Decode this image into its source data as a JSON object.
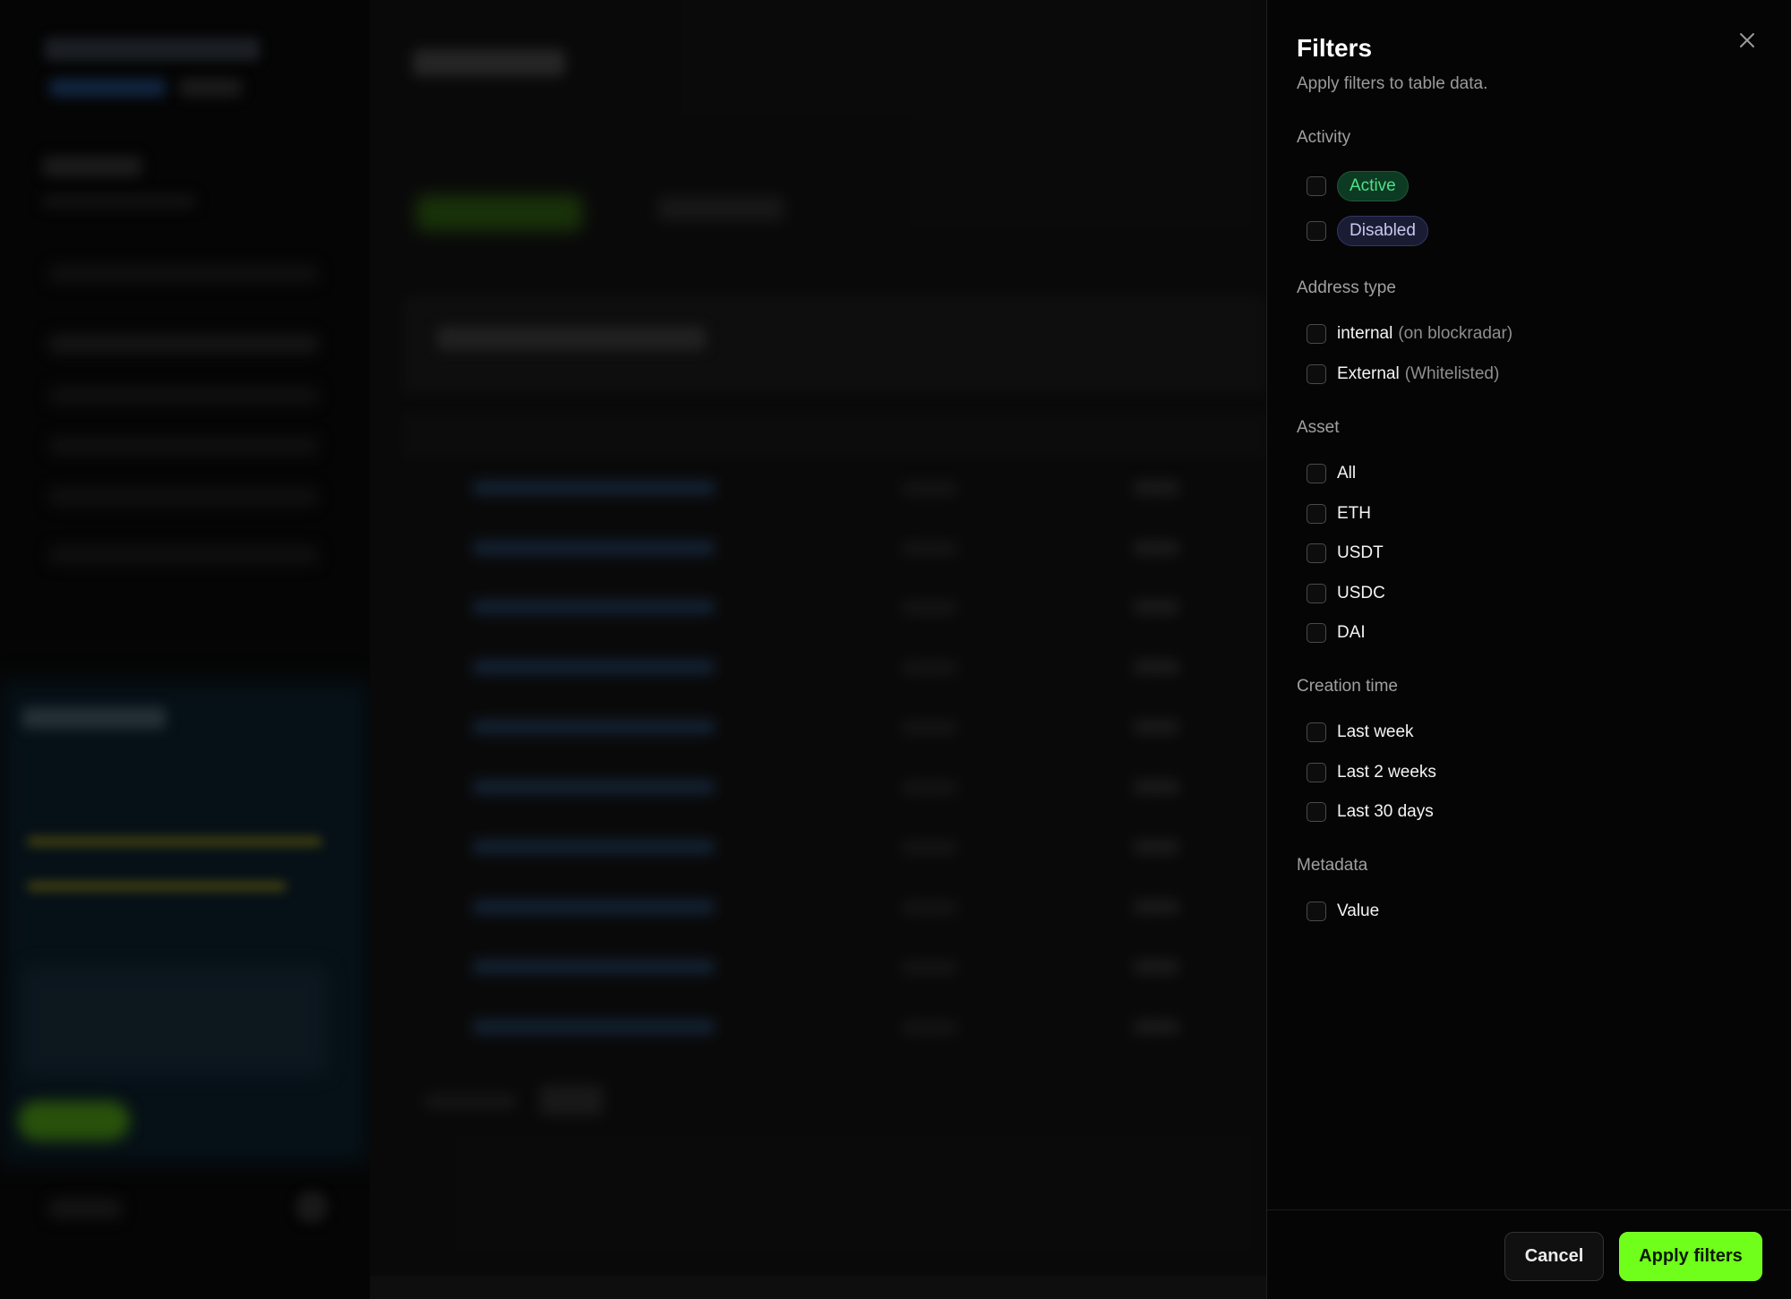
{
  "drawer": {
    "title": "Filters",
    "subtitle": "Apply filters to table data.",
    "close_icon": "close-icon",
    "sections": {
      "activity": {
        "label": "Activity",
        "options": [
          {
            "label": "Active",
            "checked": false,
            "color": "#4fe08a"
          },
          {
            "label": "Disabled",
            "checked": false,
            "color": "#c6c8f0"
          }
        ]
      },
      "address_type": {
        "label": "Address type",
        "options": [
          {
            "label": "internal",
            "extra": "(on blockradar)",
            "checked": false
          },
          {
            "label": "External",
            "extra": "(Whitelisted)",
            "checked": false
          }
        ]
      },
      "asset": {
        "label": "Asset",
        "options": [
          {
            "label": "All",
            "checked": false
          },
          {
            "label": "ETH",
            "checked": false
          },
          {
            "label": "USDT",
            "checked": false
          },
          {
            "label": "USDC",
            "checked": false
          },
          {
            "label": "DAI",
            "checked": false
          }
        ]
      },
      "creation_time": {
        "label": "Creation time",
        "options": [
          {
            "label": "Last week",
            "checked": false
          },
          {
            "label": "Last 2 weeks",
            "checked": false
          },
          {
            "label": "Last 30 days",
            "checked": false
          }
        ]
      },
      "metadata": {
        "label": "Metadata",
        "options": [
          {
            "label": "Value",
            "checked": false
          }
        ]
      }
    },
    "footer": {
      "cancel_label": "Cancel",
      "apply_label": "Apply filters",
      "apply_color": "#6fff1a"
    }
  }
}
